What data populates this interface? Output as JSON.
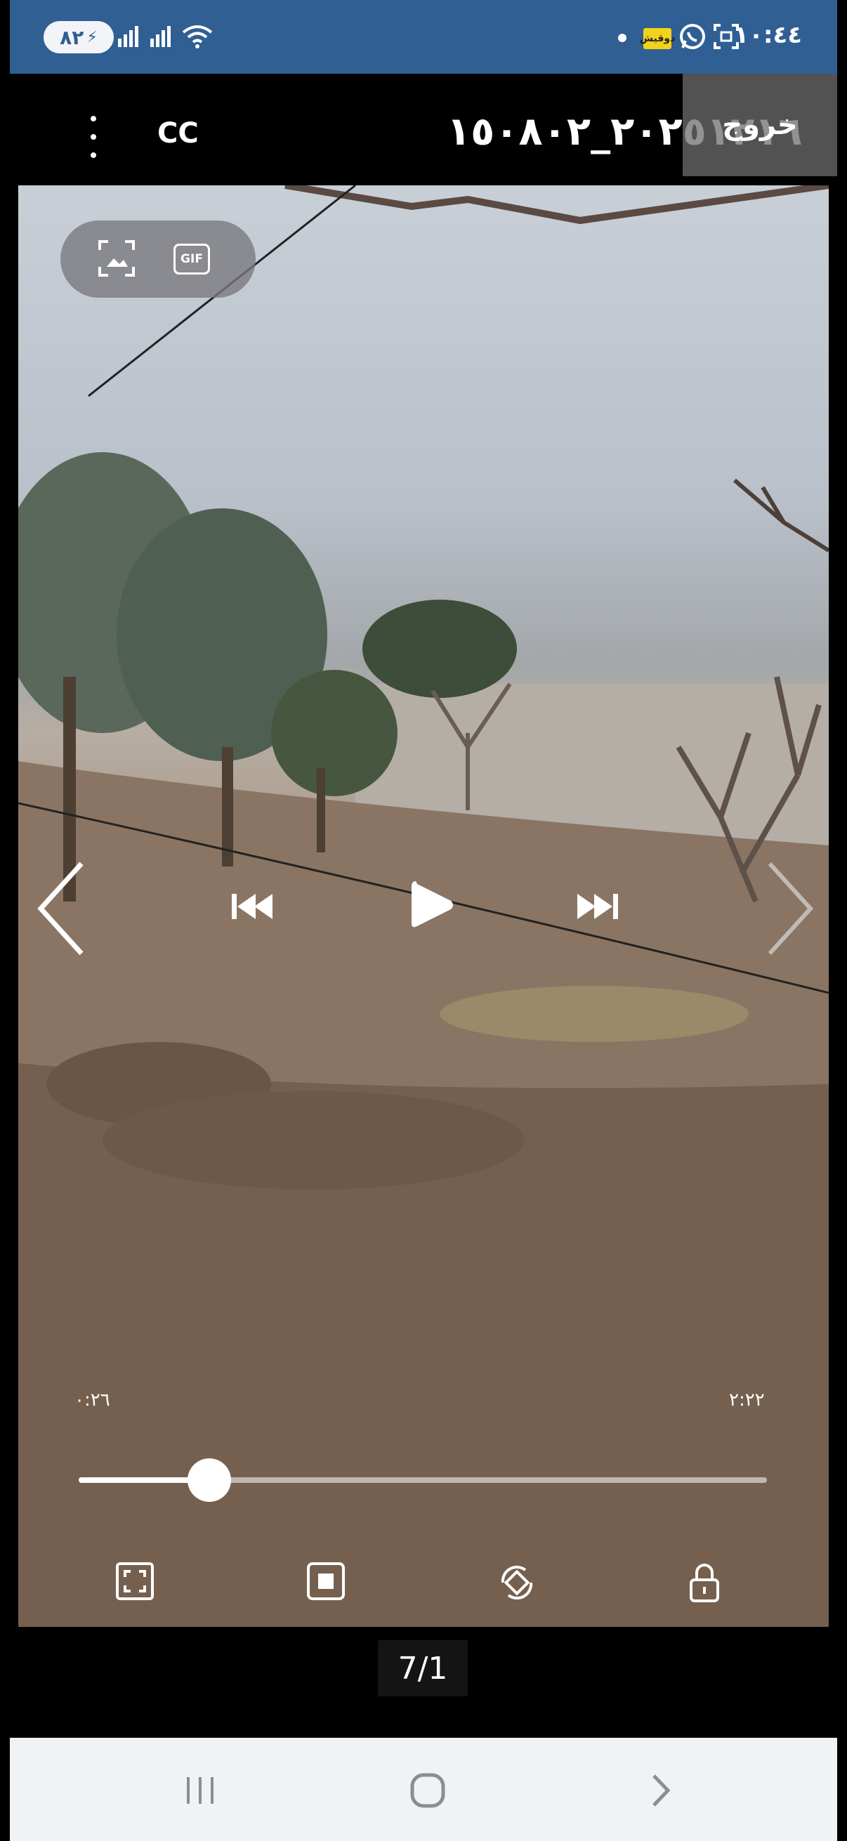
{
  "status_bar": {
    "battery": "٨٢",
    "clock": "١٠:٤٤",
    "notification_badge": "دوقيش",
    "icons": [
      "battery-charging-icon",
      "signal-icon",
      "signal-icon",
      "wifi-icon",
      "dot-icon",
      "notification-badge",
      "whatsapp-icon",
      "screenshot-icon"
    ]
  },
  "top_bar": {
    "menu_icon": "more-vertical-icon",
    "cc_label": "CC",
    "file_title": "٢٠٢٥١٢١٦_١٥٠٨٠٢",
    "exit_label": "خروج"
  },
  "video": {
    "capture_icons": [
      "capture-image-icon",
      "gif-icon"
    ],
    "gif_label": "GIF",
    "nav_icons": [
      "chevron-left-icon",
      "chevron-right-icon"
    ],
    "playback_icons": [
      "previous-icon",
      "play-icon",
      "next-icon"
    ],
    "time_elapsed": "٠:٢٦",
    "time_total": "٢:٢٢",
    "progress": 0.19,
    "bottom_controls": [
      "fullscreen-icon",
      "popup-player-icon",
      "rotate-icon",
      "lock-icon"
    ]
  },
  "counter": "7/1",
  "nav_bar": {
    "icons": [
      "recent-apps-icon",
      "home-icon",
      "back-icon"
    ]
  },
  "colors": {
    "status_bar": "#2f5f93",
    "nav_bar": "#f1f2f4"
  }
}
